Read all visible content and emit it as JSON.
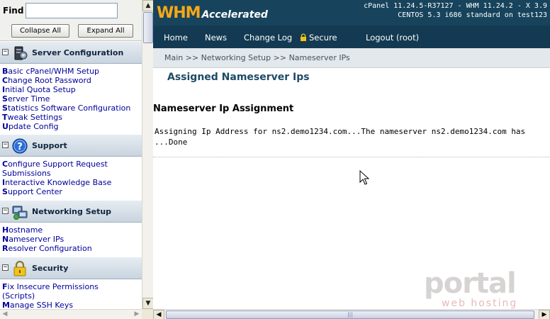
{
  "sidebar": {
    "find_label": "Find",
    "find_value": "",
    "collapse_label": "Collapse All",
    "expand_label": "Expand All",
    "sections": [
      {
        "title": "Server Configuration",
        "icon": "server-icon",
        "links": [
          {
            "first": "B",
            "rest": "asic cPanel/WHM Setup"
          },
          {
            "first": "C",
            "rest": "hange Root Password"
          },
          {
            "first": "I",
            "rest": "nitial Quota Setup"
          },
          {
            "first": "S",
            "rest": "erver Time"
          },
          {
            "first": "S",
            "rest": "tatistics Software Configuration"
          },
          {
            "first": "T",
            "rest": "weak Settings"
          },
          {
            "first": "U",
            "rest": "pdate Config"
          }
        ]
      },
      {
        "title": "Support",
        "icon": "help-icon",
        "links": [
          {
            "first": "C",
            "rest": "onfigure Support Request"
          },
          {
            "first": "",
            "rest": "Submissions"
          },
          {
            "first": "I",
            "rest": "nteractive Knowledge Base"
          },
          {
            "first": "S",
            "rest": "upport Center"
          }
        ]
      },
      {
        "title": "Networking Setup",
        "icon": "network-icon",
        "links": [
          {
            "first": "H",
            "rest": "ostname"
          },
          {
            "first": "N",
            "rest": "ameserver IPs"
          },
          {
            "first": "R",
            "rest": "esolver Configuration"
          }
        ]
      },
      {
        "title": "Security",
        "icon": "lock-icon",
        "links": [
          {
            "first": "F",
            "rest": "ix Insecure Permissions"
          },
          {
            "first": "",
            "rest": "(Scripts)"
          },
          {
            "first": "M",
            "rest": "anage SSH Keys"
          }
        ]
      }
    ]
  },
  "header": {
    "logo_main": "WHM",
    "logo_sub": "Accelerated",
    "version_line1": "cPanel 11.24.5-R37127 - WHM 11.24.2 - X 3.9",
    "version_line2": "CENTOS 5.3 i686 standard on test123"
  },
  "nav": {
    "home": "Home",
    "news": "News",
    "changelog": "Change Log",
    "secure": "Secure",
    "logout": "Logout (root)"
  },
  "breadcrumb": "Main >> Networking Setup >> Nameserver IPs",
  "main": {
    "title": "Assigned Nameserver Ips",
    "heading": "Nameserver Ip Assignment",
    "output_line1": "Assigning Ip Address for ns2.demo1234.com...The nameserver ns2.demo1234.com has",
    "output_line2": "...Done"
  },
  "watermark": {
    "brand": "portal",
    "sub": "web hosting"
  },
  "colors": {
    "header_bg": "#17435c",
    "logo_accent": "#f7a817",
    "link": "#00009a",
    "title": "#1d4a66"
  }
}
